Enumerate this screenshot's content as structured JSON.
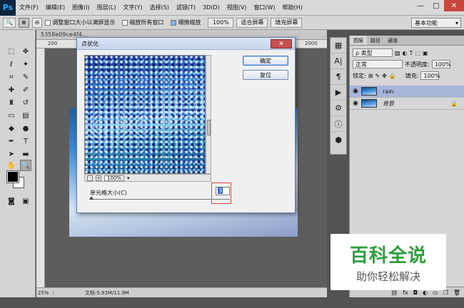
{
  "menubar": {
    "logo": "Ps",
    "items": [
      "文件(F)",
      "编辑(E)",
      "图像(I)",
      "图层(L)",
      "文字(Y)",
      "选择(S)",
      "滤镜(T)",
      "3D(D)",
      "视图(V)",
      "窗口(W)",
      "帮助(H)"
    ],
    "win_min": "—",
    "win_max": "□",
    "win_close": "✕"
  },
  "options": {
    "tool_icon": "🔍",
    "resize_windows": "调整窗口大小以满屏显示",
    "zoom_all": "缩放所有窗口",
    "scrubby_zoom": "细微缩放",
    "zoom_value": "100%",
    "fit_screen": "适合屏幕",
    "fill_screen": "填充屏幕",
    "workspace": "基本功能"
  },
  "document": {
    "tab_label": "5358e09ce4f4...",
    "ruler_200": "200",
    "ruler_2000": "2000",
    "status_zoom": "25%",
    "status_info": "文档:5.93M/11.9M"
  },
  "dialog": {
    "title": "点状化",
    "close": "✕",
    "ok_label": "确定",
    "reset_label": "复位",
    "zoom_minus": "-",
    "zoom_plus": "+",
    "zoom_value": "100%",
    "cell_size_label": "单元格大小(C)",
    "cell_size_value": "3",
    "cell_size_fraction": 0.0
  },
  "layers": {
    "tabs": [
      "图层",
      "路径",
      "通道"
    ],
    "kind_filter": "类型",
    "blend_mode": "正常",
    "opacity_label": "不透明度:",
    "opacity_value": "100%",
    "lock_label": "锁定:",
    "fill_label": "填充:",
    "fill_value": "100%",
    "items": [
      {
        "name": "rain",
        "selected": true
      },
      {
        "name": "背景",
        "selected": false,
        "locked": true
      }
    ],
    "footer_icons": [
      "link-icon",
      "fx-icon",
      "mask-icon",
      "adjustment-icon",
      "group-icon",
      "new-layer-icon",
      "trash-icon"
    ]
  },
  "watermark": {
    "title": "百科全说",
    "subtitle": "助你轻松解决"
  },
  "colors": {
    "accent": "#2e9e3e",
    "selected_layer": "#a7b6d9",
    "dialog_bg": "#f0f0f0",
    "highlight_box": "#e04545"
  }
}
